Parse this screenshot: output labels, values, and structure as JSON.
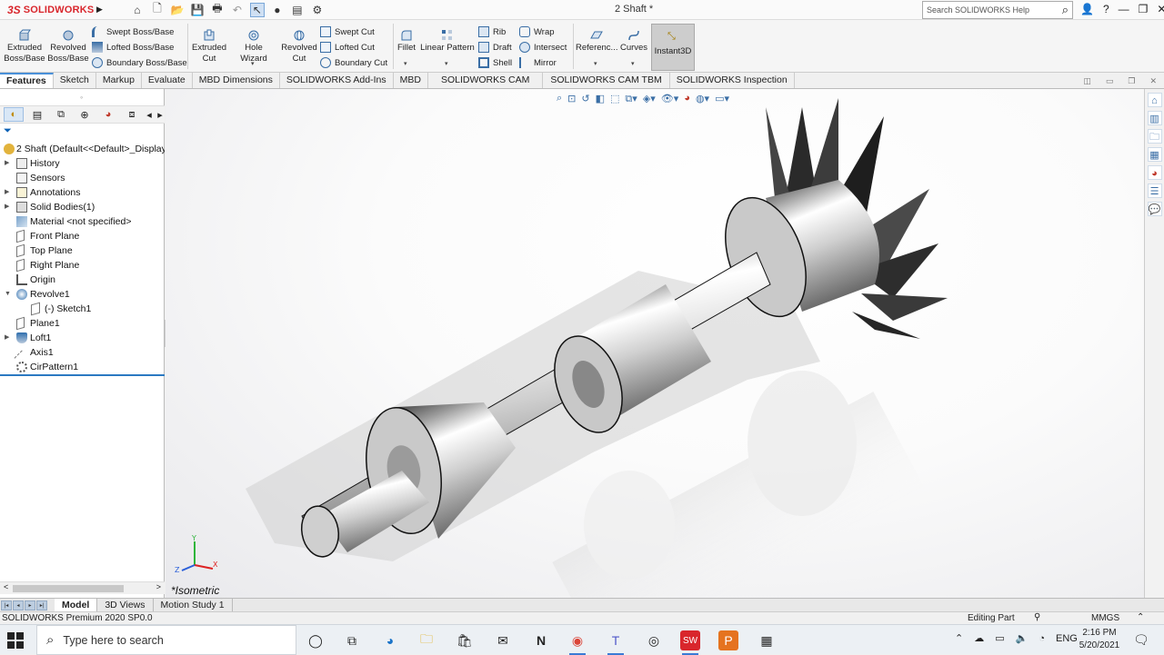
{
  "titlebar": {
    "app_name": "SOLIDWORKS",
    "logo_mark": "3S",
    "doc_title": "2 Shaft *",
    "search_placeholder": "Search SOLIDWORKS Help",
    "help": "?"
  },
  "ribbon": {
    "extruded_boss": "Extruded Boss/Base",
    "revolved_boss": "Revolved Boss/Base",
    "swept_boss": "Swept Boss/Base",
    "lofted_boss": "Lofted Boss/Base",
    "boundary_boss": "Boundary Boss/Base",
    "extruded_cut": "Extruded Cut",
    "hole_wizard": "Hole Wizard",
    "revolved_cut": "Revolved Cut",
    "swept_cut": "Swept Cut",
    "lofted_cut": "Lofted Cut",
    "boundary_cut": "Boundary Cut",
    "fillet": "Fillet",
    "linear_pattern": "Linear Pattern",
    "rib": "Rib",
    "draft": "Draft",
    "shell": "Shell",
    "wrap": "Wrap",
    "intersect": "Intersect",
    "mirror": "Mirror",
    "reference": "Referenc...",
    "curves": "Curves",
    "instant3d": "Instant3D"
  },
  "tabs": [
    {
      "label": "Features",
      "active": true
    },
    {
      "label": "Sketch"
    },
    {
      "label": "Markup"
    },
    {
      "label": "Evaluate"
    },
    {
      "label": "MBD Dimensions"
    },
    {
      "label": "SOLIDWORKS Add-Ins"
    },
    {
      "label": "MBD"
    },
    {
      "label": "SOLIDWORKS CAM"
    },
    {
      "label": "SOLIDWORKS CAM TBM"
    },
    {
      "label": "SOLIDWORKS Inspection"
    }
  ],
  "tree": {
    "root": "2 Shaft  (Default<<Default>_Display",
    "items": [
      {
        "label": "History",
        "expander": true
      },
      {
        "label": "Sensors"
      },
      {
        "label": "Annotations",
        "expander": true
      },
      {
        "label": "Solid Bodies(1)",
        "expander": true
      },
      {
        "label": "Material <not specified>"
      },
      {
        "label": "Front Plane"
      },
      {
        "label": "Top Plane"
      },
      {
        "label": "Right Plane"
      },
      {
        "label": "Origin"
      },
      {
        "label": "Revolve1",
        "expanded": true
      },
      {
        "label": "(-) Sketch1",
        "child": true
      },
      {
        "label": "Plane1"
      },
      {
        "label": "Loft1",
        "expander": true
      },
      {
        "label": "Axis1"
      },
      {
        "label": "CirPattern1"
      }
    ]
  },
  "viewport": {
    "view_name": "*Isometric",
    "triad": {
      "y": "Y",
      "x": "X",
      "z": "Z"
    }
  },
  "bottom_tabs": [
    {
      "label": "Model",
      "active": true
    },
    {
      "label": "3D Views"
    },
    {
      "label": "Motion Study 1"
    }
  ],
  "status": {
    "version": "SOLIDWORKS Premium 2020 SP0.0",
    "mode": "Editing Part",
    "units": "MMGS"
  },
  "taskbar": {
    "search_placeholder": "Type here to search",
    "lang": "ENG",
    "time": "2:16 PM",
    "date": "5/20/2021"
  },
  "colors": {
    "brand": "#d9262c",
    "accent": "#2b79c2"
  }
}
